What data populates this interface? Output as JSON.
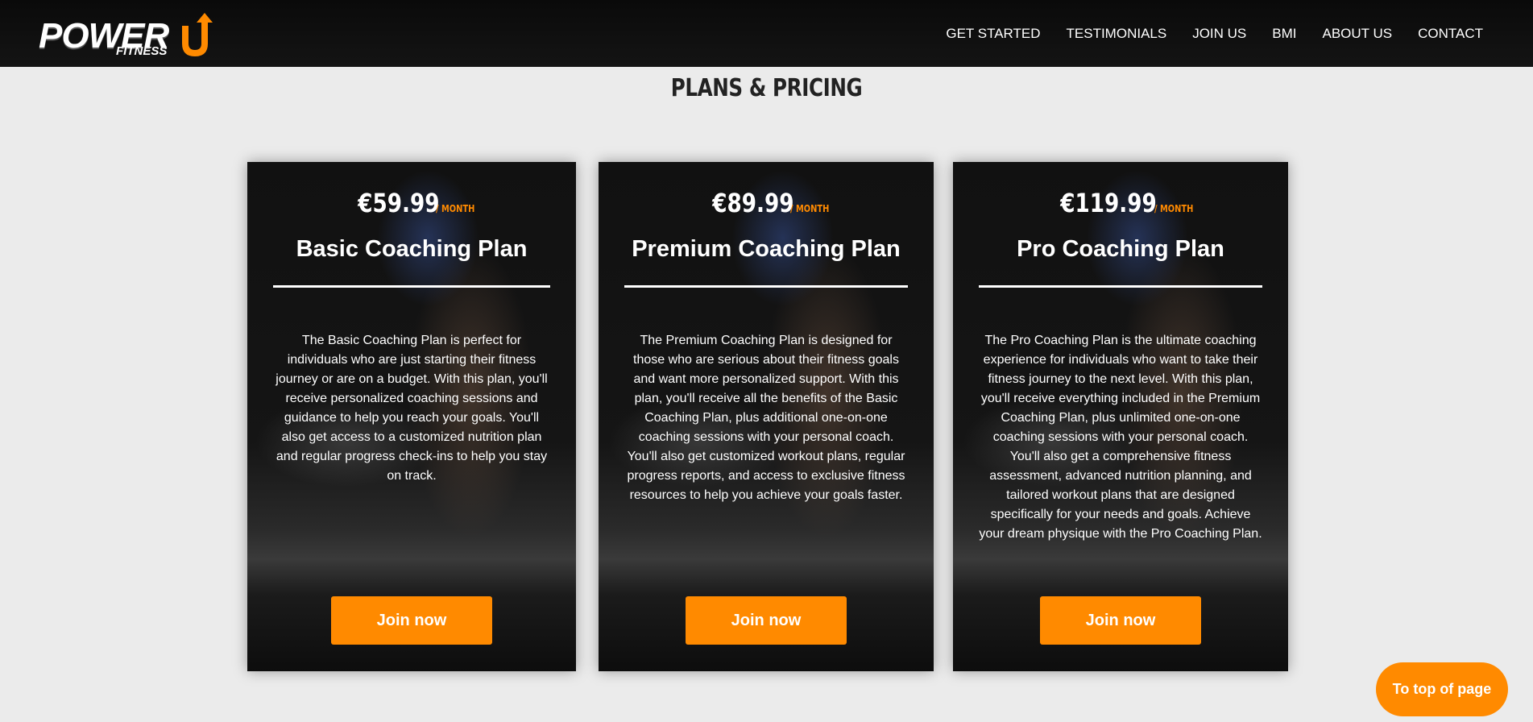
{
  "brand": {
    "name": "POWER",
    "sub": "FITNESS",
    "accent": "#ff8a00"
  },
  "nav": {
    "items": [
      {
        "label": "GET STARTED"
      },
      {
        "label": "TESTIMONIALS"
      },
      {
        "label": "JOIN US"
      },
      {
        "label": "BMI"
      },
      {
        "label": "ABOUT US"
      },
      {
        "label": "CONTACT"
      }
    ]
  },
  "section": {
    "title": "PLANS & PRICING"
  },
  "plans": [
    {
      "price": "€59.99",
      "period": "/ MONTH",
      "name": "Basic Coaching Plan",
      "description": "The Basic Coaching Plan is perfect for individuals who are just starting their fitness journey or are on a budget. With this plan, you'll receive personalized coaching sessions and guidance to help you reach your goals. You'll also get access to a customized nutrition plan and regular progress check-ins to help you stay on track.",
      "button": "Join now"
    },
    {
      "price": "€89.99",
      "period": "/ MONTH",
      "name": "Premium Coaching Plan",
      "description": "The Premium Coaching Plan is designed for those who are serious about their fitness goals and want more personalized support. With this plan, you'll receive all the benefits of the Basic Coaching Plan, plus additional one-on-one coaching sessions with your personal coach. You'll also get customized workout plans, regular progress reports, and access to exclusive fitness resources to help you achieve your goals faster.",
      "button": "Join now"
    },
    {
      "price": "€119.99",
      "period": "/ MONTH",
      "name": "Pro Coaching Plan",
      "description": "The Pro Coaching Plan is the ultimate coaching experience for individuals who want to take their fitness journey to the next level. With this plan, you'll receive everything included in the Premium Coaching Plan, plus unlimited one-on-one coaching sessions with your personal coach. You'll also get a comprehensive fitness assessment, advanced nutrition planning, and tailored workout plans that are designed specifically for your needs and goals. Achieve your dream physique with the Pro Coaching Plan.",
      "button": "Join now"
    }
  ],
  "scroll_top": {
    "label": "To top of page"
  }
}
